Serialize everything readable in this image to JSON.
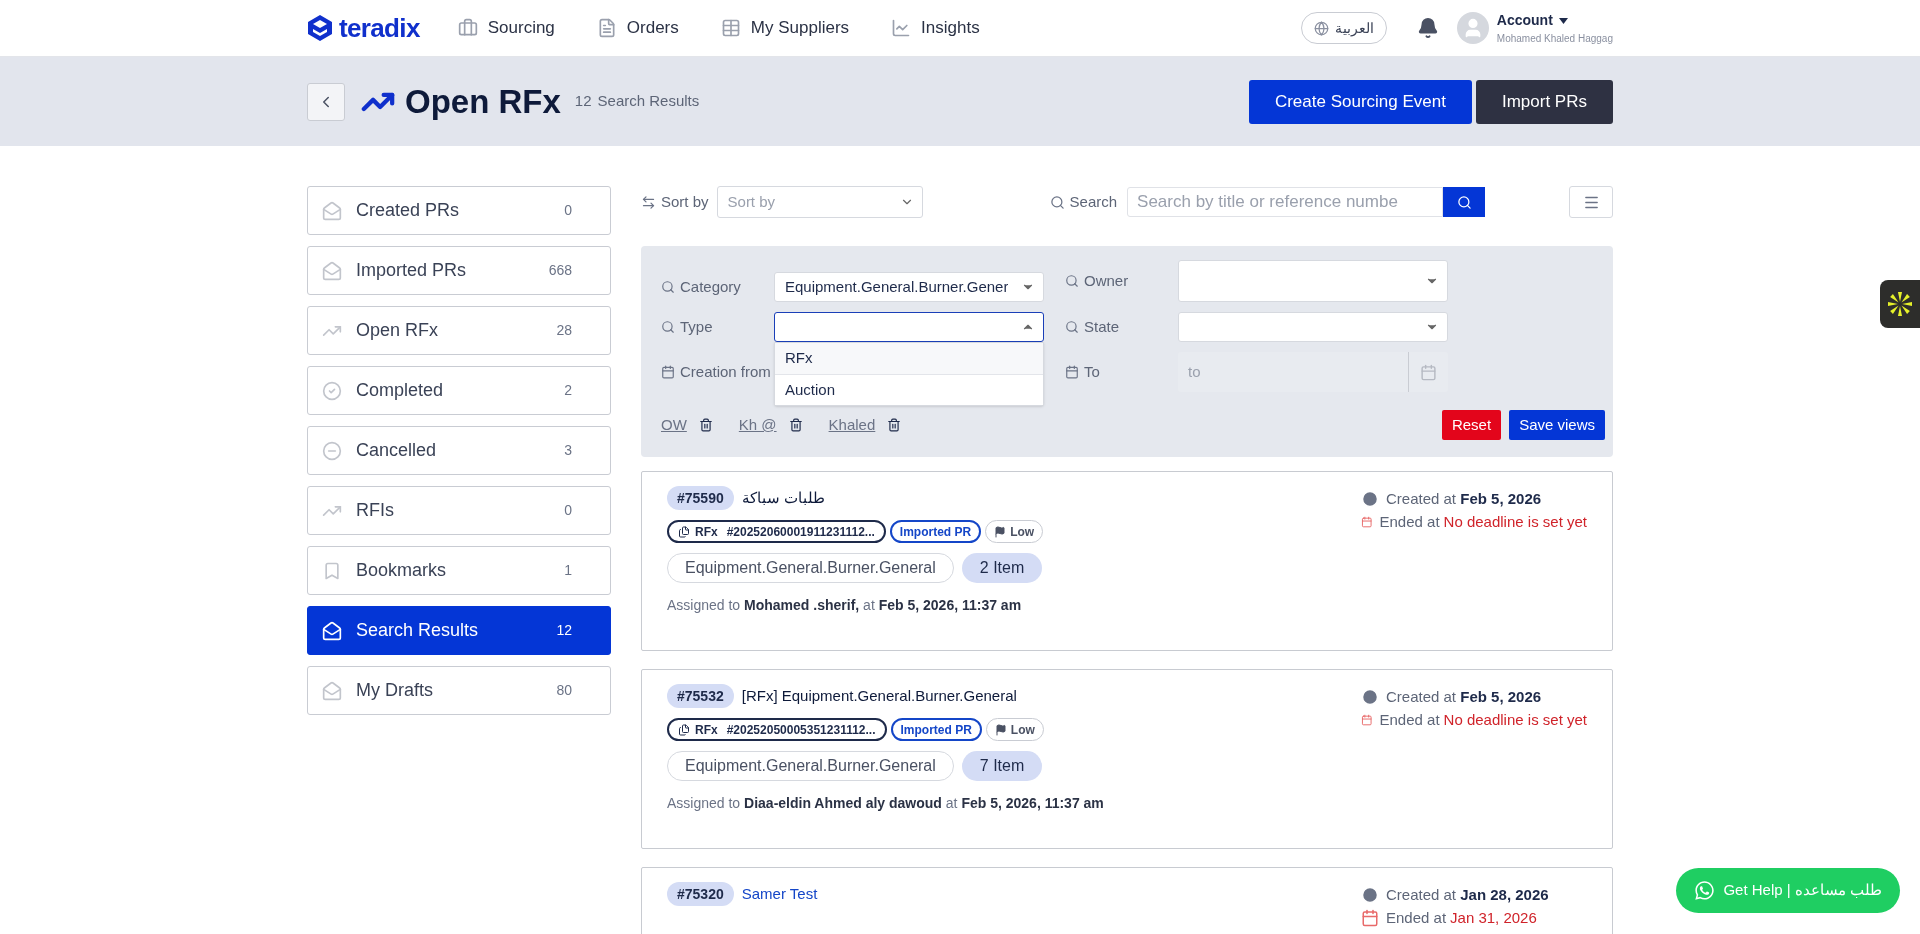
{
  "header": {
    "logo": "teradix",
    "nav": [
      {
        "label": "Sourcing"
      },
      {
        "label": "Orders"
      },
      {
        "label": "My Suppliers"
      },
      {
        "label": "Insights"
      }
    ],
    "language": "العربية",
    "account": {
      "label": "Account",
      "name": "Mohamed Khaled Haggag"
    }
  },
  "page_header": {
    "title": "Open RFx",
    "count": "12",
    "count_label": "Search Results",
    "buttons": [
      {
        "label": "Create Sourcing Event",
        "kind": "primary"
      },
      {
        "label": "Import PRs",
        "kind": "dark"
      }
    ]
  },
  "sidebar": {
    "items": [
      {
        "label": "Created PRs",
        "count": "0",
        "selected": false
      },
      {
        "label": "Imported PRs",
        "count": "668",
        "selected": false
      },
      {
        "label": "Open RFx",
        "count": "28",
        "selected": false
      },
      {
        "label": "Completed",
        "count": "2",
        "selected": false
      },
      {
        "label": "Cancelled",
        "count": "3",
        "selected": false
      },
      {
        "label": "RFIs",
        "count": "0",
        "selected": false
      },
      {
        "label": "Bookmarks",
        "count": "1",
        "selected": false
      },
      {
        "label": "Search Results",
        "count": "12",
        "selected": true
      },
      {
        "label": "My Drafts",
        "count": "80",
        "selected": false
      }
    ]
  },
  "toolbar": {
    "sort_label": "Sort by",
    "sort_placeholder": "Sort by",
    "search_label": "Search",
    "search_placeholder": "Search by title or reference numbe"
  },
  "filters": {
    "category": {
      "label": "Category",
      "value": "Equipment.General.Burner.Gener"
    },
    "owner": {
      "label": "Owner"
    },
    "type": {
      "label": "Type",
      "open": true,
      "options": [
        {
          "label": "RFx",
          "selected": false
        },
        {
          "label": "Auction",
          "selected": false
        }
      ]
    },
    "state": {
      "label": "State"
    },
    "creation_from": {
      "label": "Creation from"
    },
    "to": {
      "label": "To",
      "placeholder": "to",
      "disabled": true
    },
    "saved_views": [
      "OW",
      "Kh @",
      "Khaled"
    ],
    "buttons": [
      {
        "label": "Reset",
        "kind": "danger"
      },
      {
        "label": "Save views",
        "kind": "primary"
      }
    ]
  },
  "cards": [
    {
      "id": "#75590",
      "title": "طلبات سباكة",
      "link": false,
      "ref_type": "RFx",
      "ref": "#20252060001911231112...",
      "source": "Imported PR",
      "priority": "Low",
      "category": "Equipment.General.Burner.General",
      "items": "2 Item",
      "assigned": "Assigned to **Mohamed .sherif,** at **Feb 5, 2026, 11:37 am**",
      "created": "Created at **Feb 5, 2026**",
      "ended_label": "Ended at",
      "ended": "No deadline is set yet"
    },
    {
      "id": "#75532",
      "title": "[RFx] Equipment.General.Burner.General",
      "link": false,
      "ref_type": "RFx",
      "ref": "#20252050005351231112...",
      "source": "Imported PR",
      "priority": "Low",
      "category": "Equipment.General.Burner.General",
      "items": "7 Item",
      "assigned": "Assigned to **Diaa-eldin Ahmed aly dawoud** at **Feb 5, 2026, 11:37 am**",
      "created": "Created at **Feb 5, 2026**",
      "ended_label": "Ended at",
      "ended": "No deadline is set yet"
    },
    {
      "id": "#75320",
      "title": "Samer Test",
      "link": true,
      "created": "Created at **Jan 28, 2026**",
      "ended_label": "Ended at",
      "ended": "Jan 31, 2026"
    }
  ],
  "help": {
    "label": "Get Help | طلب مساعده"
  }
}
